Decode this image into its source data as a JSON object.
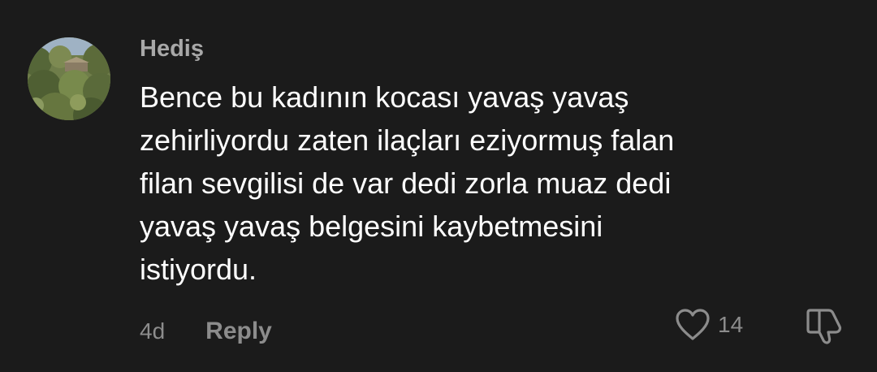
{
  "comment": {
    "author": "Hediş",
    "avatar_icon": "landscape-avatar",
    "text_lines": [
      "Bence bu kadının kocası yavaş yavaş",
      "zehirliyordu zaten ilaçları eziyormuş falan",
      "filan sevgilisi de var dedi zorla muaz dedi",
      "yavaş yavaş belgesini kaybetmesini",
      "istiyordu."
    ],
    "time": "4d",
    "reply_label": "Reply",
    "like_count": "14",
    "like_icon": "heart-outline-icon",
    "dislike_icon": "thumbs-down-icon"
  },
  "colors": {
    "background": "#1b1b1b",
    "text": "#ffffff",
    "muted": "#8c8c8c",
    "author": "#a8a8a8"
  }
}
